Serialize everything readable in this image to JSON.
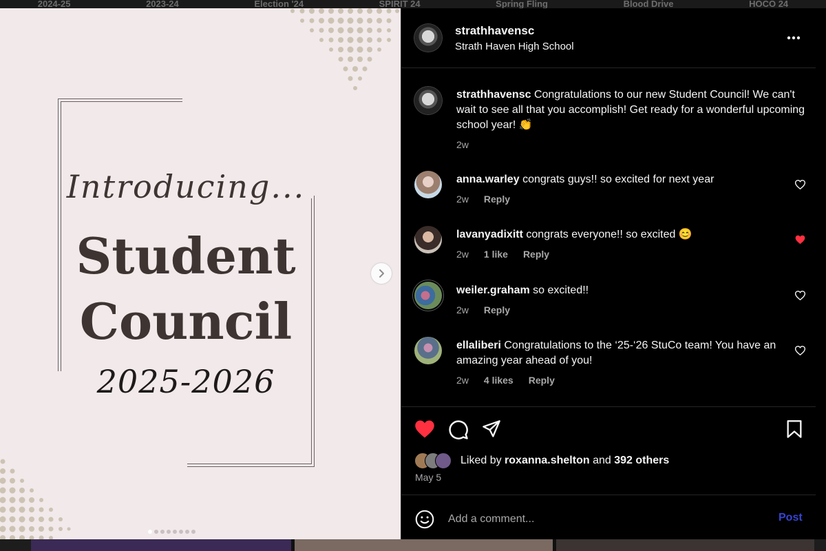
{
  "background_tabs": [
    "2024-25",
    "2023-24",
    "Election '24",
    "SPIRIT 24",
    "Spring Fling",
    "Blood Drive",
    "HOCO 24"
  ],
  "image": {
    "intro": "Introducing...",
    "title_line1": "Student",
    "title_line2": "Council",
    "years": "2025-2026",
    "slide_count": 8,
    "active_slide": 1
  },
  "post": {
    "username": "strathhavensc",
    "location": "Strath Haven High School",
    "caption_user": "strathhavensc",
    "caption": "Congratulations to our new Student Council! We can't wait to see all that you accomplish! Get ready for a wonderful upcoming school year! 👏",
    "caption_time": "2w",
    "date": "May 5",
    "liked_by_prefix": "Liked by",
    "liked_by_user": "roxanna.shelton",
    "liked_by_and": "and",
    "liked_by_others": "392 others",
    "post_liked": true
  },
  "comments": [
    {
      "user": "anna.warley",
      "text": "congrats guys!! so excited for next year",
      "time": "2w",
      "likes": "",
      "reply": "Reply",
      "liked": false
    },
    {
      "user": "lavanyadixitt",
      "text": "congrats everyone!! so excited 😊",
      "time": "2w",
      "likes": "1 like",
      "reply": "Reply",
      "liked": true
    },
    {
      "user": "weiler.graham",
      "text": "so excited!!",
      "time": "2w",
      "likes": "",
      "reply": "Reply",
      "liked": false
    },
    {
      "user": "ellaliberi",
      "text": "Congratulations to the ‘25-‘26 StuCo team! You have an amazing year ahead of you!",
      "time": "2w",
      "likes": "4 likes",
      "reply": "Reply",
      "liked": false
    }
  ],
  "composer": {
    "placeholder": "Add a comment...",
    "post_label": "Post"
  },
  "colors": {
    "like_red": "#ff3040",
    "post_blue": "#4150f7",
    "image_bg": "#f1e9ea",
    "panel_bg": "#000000"
  },
  "icons": [
    "more-icon",
    "heart-icon",
    "comment-icon",
    "share-icon",
    "bookmark-icon",
    "emoji-icon",
    "chevron-right-icon"
  ]
}
